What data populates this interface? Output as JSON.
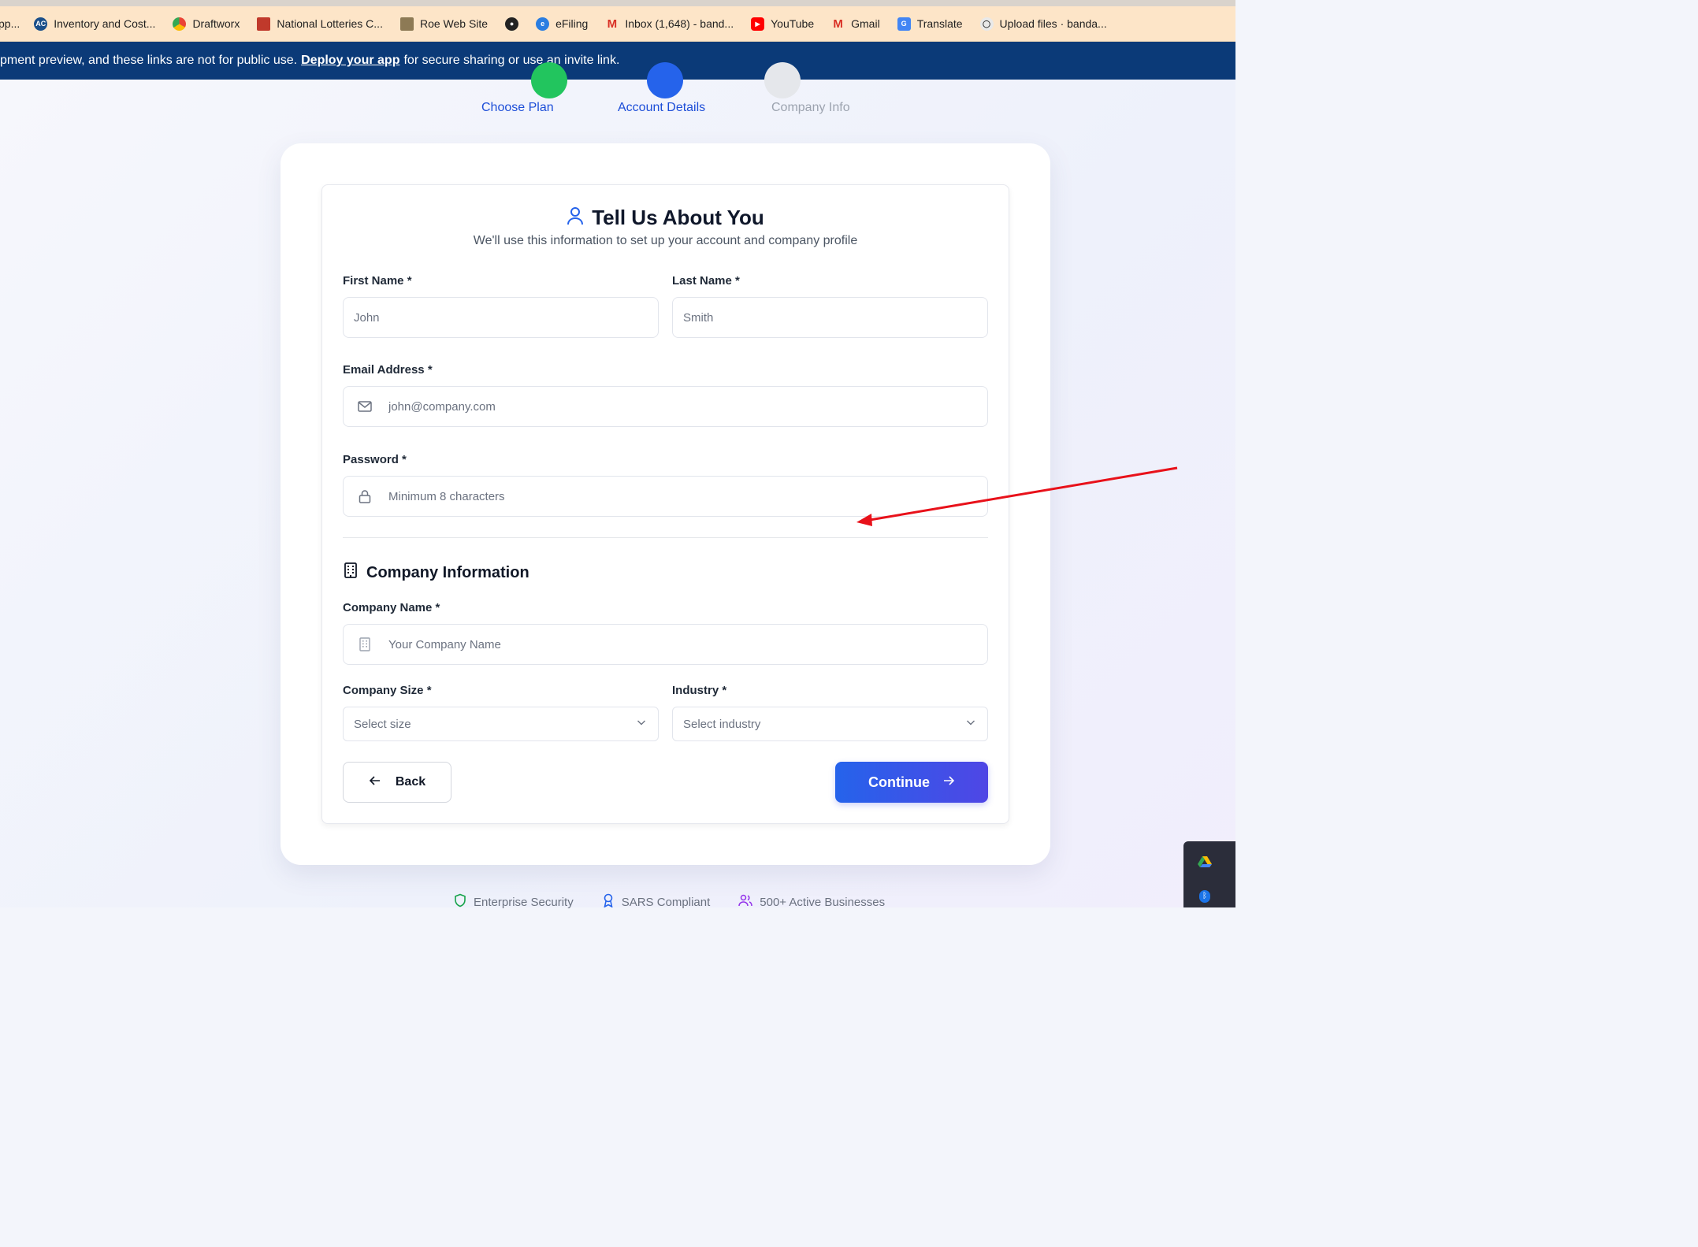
{
  "bookmarks": [
    {
      "label": "pp...",
      "icon": "app-icon"
    },
    {
      "label": "Inventory and Cost...",
      "icon": "ac-logo-icon"
    },
    {
      "label": "Draftworx",
      "icon": "chrome-icon"
    },
    {
      "label": "National Lotteries C...",
      "icon": "lotteries-icon"
    },
    {
      "label": "Roe Web Site",
      "icon": "roe-icon"
    },
    {
      "label": "",
      "icon": "globe-icon"
    },
    {
      "label": "eFiling",
      "icon": "efiling-icon"
    },
    {
      "label": "Inbox (1,648) - band...",
      "icon": "gmail-icon"
    },
    {
      "label": "YouTube",
      "icon": "youtube-icon"
    },
    {
      "label": "Gmail",
      "icon": "gmail-icon"
    },
    {
      "label": "Translate",
      "icon": "translate-icon"
    },
    {
      "label": "Upload files · banda...",
      "icon": "github-icon"
    }
  ],
  "banner": {
    "text_before": "pment preview, and these links are not for public use.",
    "link": "Deploy your app",
    "text_after": "for secure sharing or use an invite link."
  },
  "stepper": {
    "steps": [
      {
        "label": "Choose Plan",
        "state": "complete"
      },
      {
        "label": "Account Details",
        "state": "active"
      },
      {
        "label": "Company Info",
        "state": "upcoming"
      }
    ]
  },
  "form": {
    "title": "Tell Us About You",
    "subtitle": "We'll use this information to set up your account and company profile",
    "first_name": {
      "label": "First Name *",
      "placeholder": "John",
      "value": ""
    },
    "last_name": {
      "label": "Last Name *",
      "placeholder": "Smith",
      "value": ""
    },
    "email": {
      "label": "Email Address *",
      "placeholder": "john@company.com",
      "value": ""
    },
    "password": {
      "label": "Password *",
      "placeholder": "Minimum 8 characters",
      "value": ""
    },
    "company_section_title": "Company Information",
    "company_name": {
      "label": "Company Name *",
      "placeholder": "Your Company Name",
      "value": ""
    },
    "company_size": {
      "label": "Company Size *",
      "selected": "Select size"
    },
    "industry": {
      "label": "Industry *",
      "selected": "Select industry"
    },
    "back_label": "Back",
    "continue_label": "Continue"
  },
  "badges": [
    {
      "label": "Enterprise Security",
      "icon": "shield-icon",
      "color": "#16a34a"
    },
    {
      "label": "SARS Compliant",
      "icon": "award-icon",
      "color": "#2563eb"
    },
    {
      "label": "500+ Active Businesses",
      "icon": "users-icon",
      "color": "#9333ea"
    }
  ],
  "colors": {
    "primary": "#2563eb",
    "complete": "#22c55e",
    "banner": "#0b3a78",
    "annotation_arrow": "#e8111a"
  }
}
